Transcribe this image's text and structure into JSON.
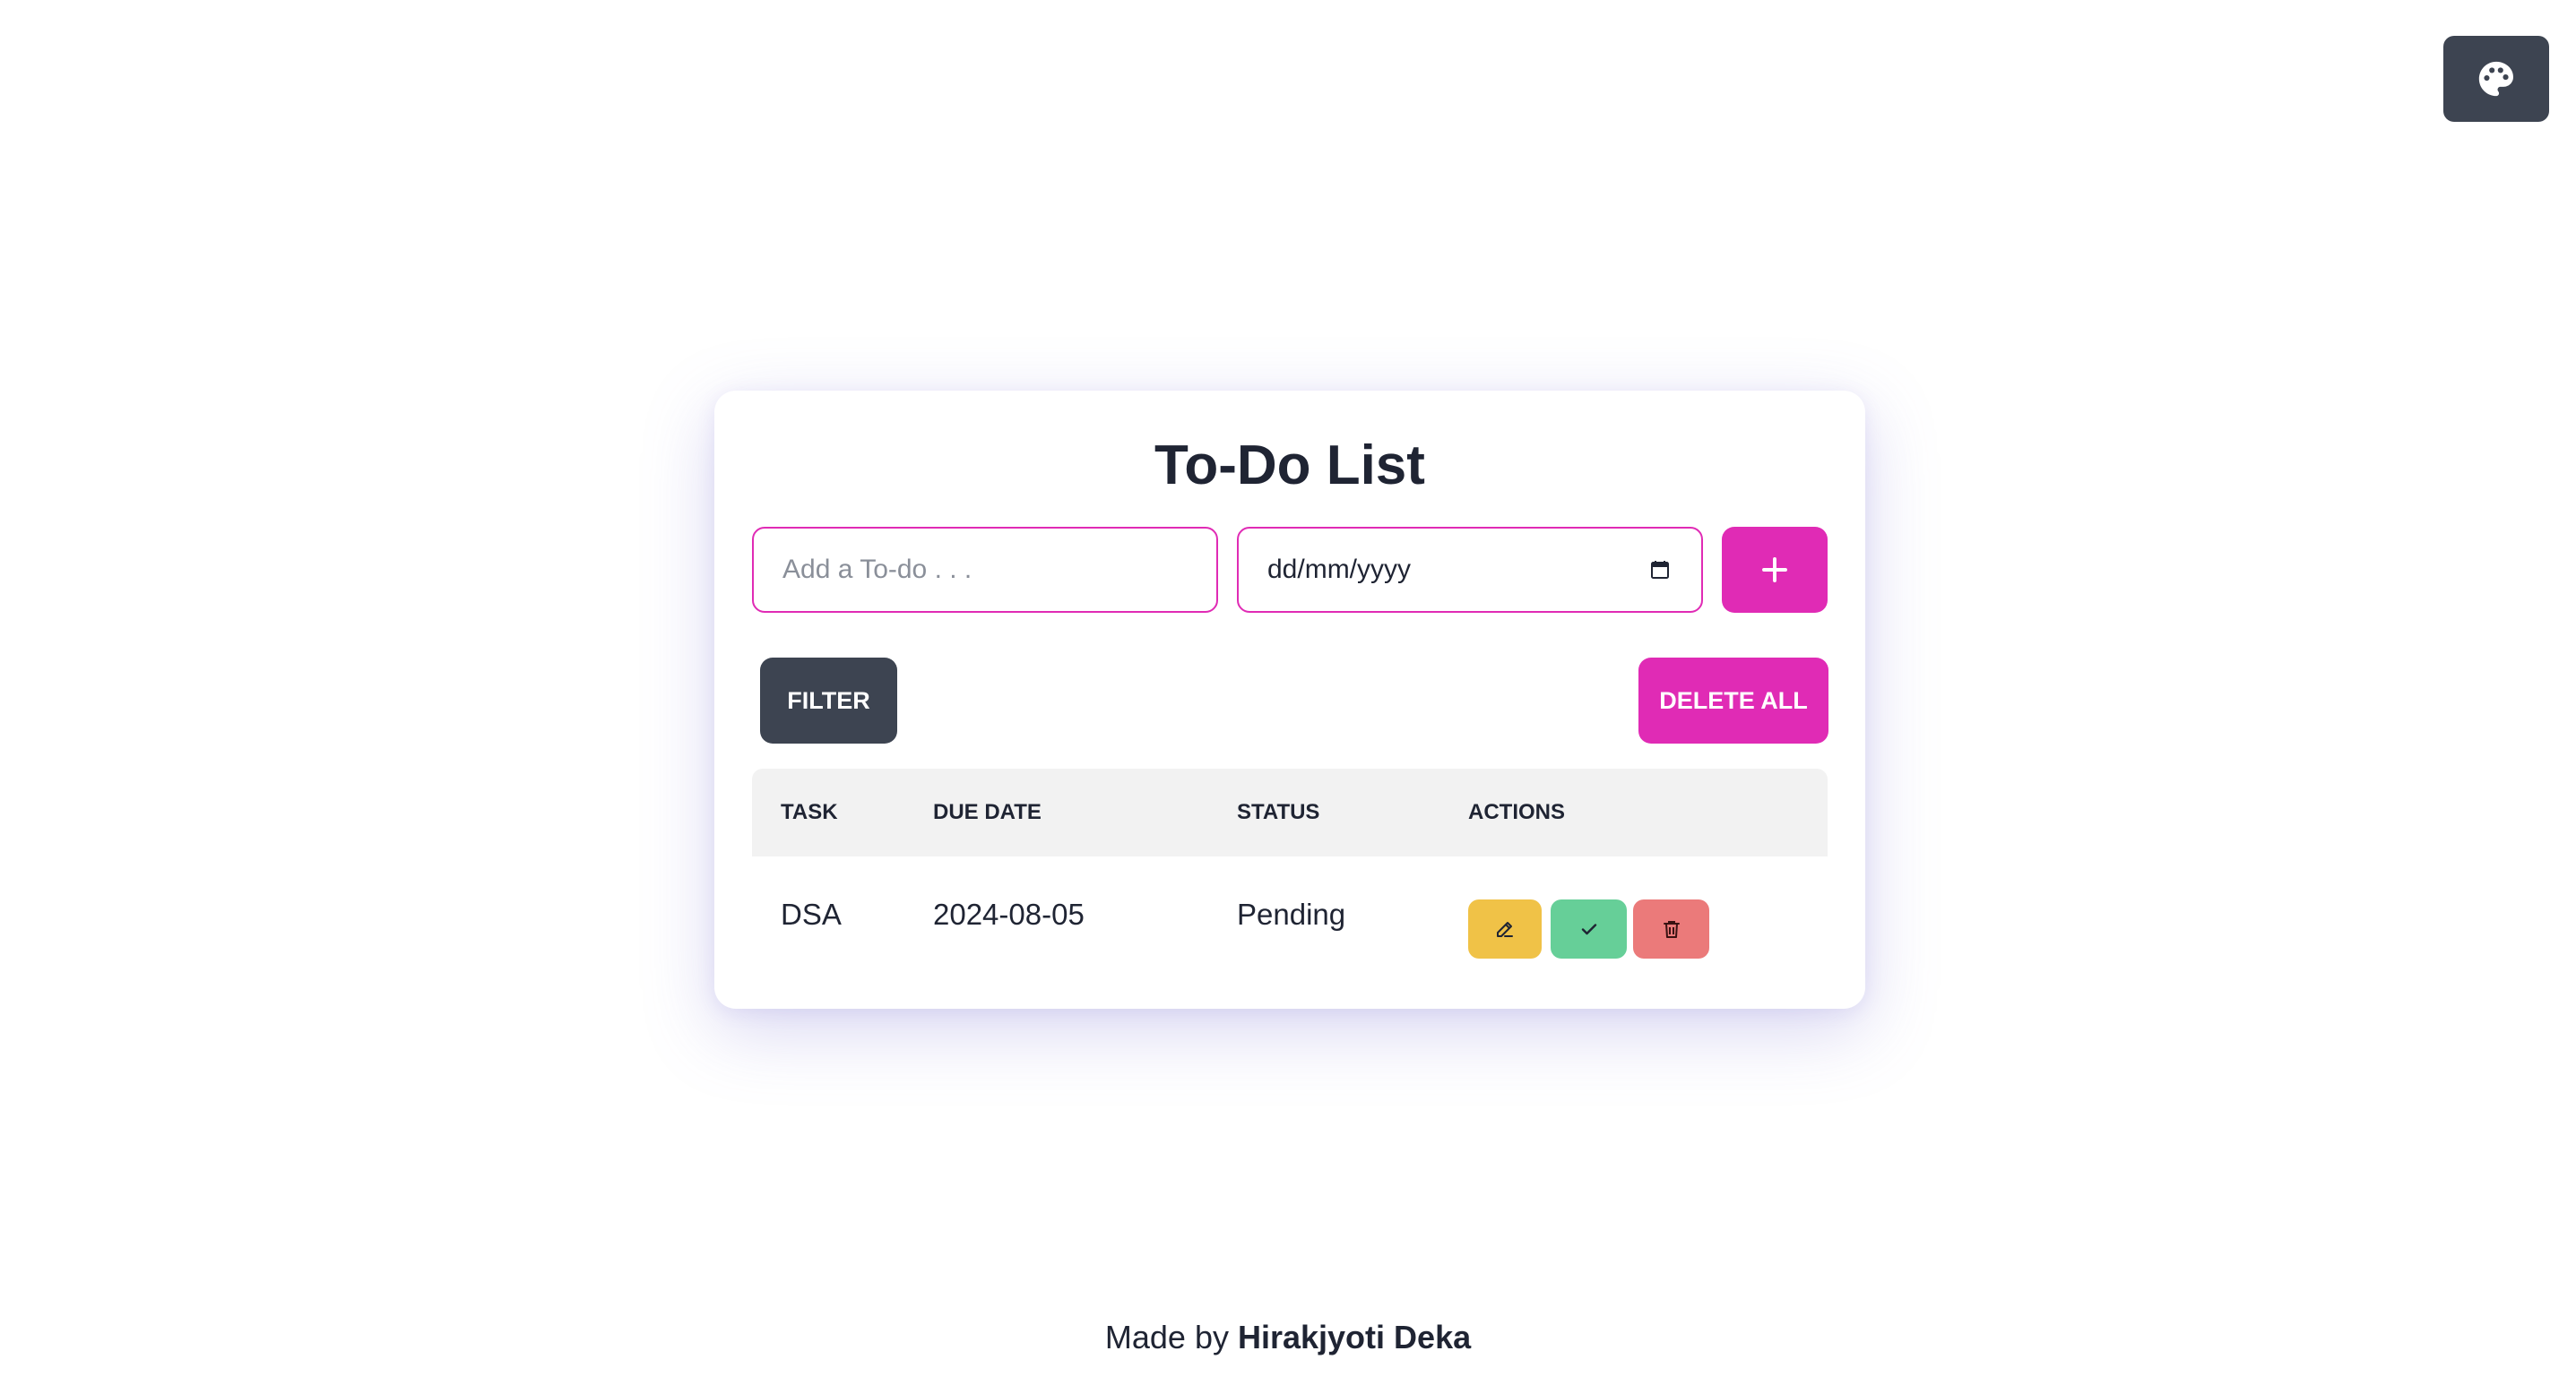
{
  "app": {
    "title": "To-Do List"
  },
  "form": {
    "todo_placeholder": "Add a To-do . . .",
    "todo_value": "",
    "date_value": "dd/mm/yyyy",
    "add_icon": "plus-icon"
  },
  "toolbar": {
    "filter_label": "FILTER",
    "delete_all_label": "DELETE ALL"
  },
  "table": {
    "headers": [
      "TASK",
      "DUE DATE",
      "STATUS",
      "ACTIONS"
    ],
    "rows": [
      {
        "task": "DSA",
        "due_date": "2024-08-05",
        "status": "Pending"
      }
    ],
    "action_icons": [
      "pencil-icon",
      "check-icon",
      "trash-icon"
    ]
  },
  "footer": {
    "prefix": "Made by",
    "author": "Hirakjyoti Deka"
  },
  "colors": {
    "accent": "#e02bb5",
    "dark": "#3d4451",
    "edit": "#f0c247",
    "done": "#66cf98",
    "delete": "#eb7a7a"
  },
  "theme_button_icon": "palette-icon"
}
